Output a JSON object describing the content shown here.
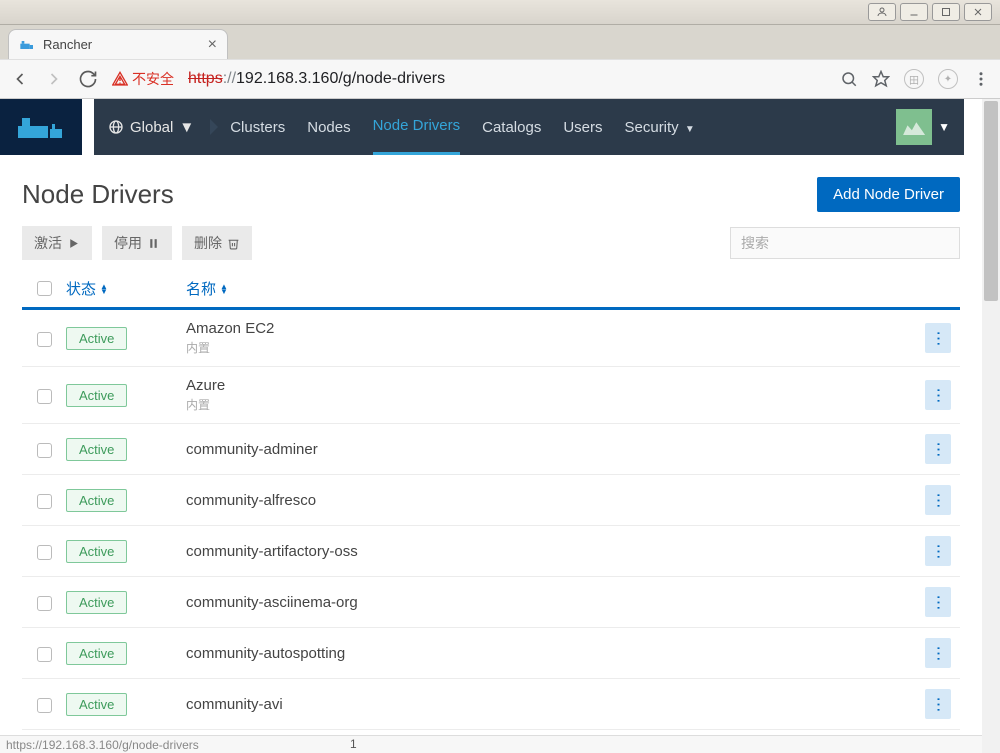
{
  "browser": {
    "tab_title": "Rancher",
    "insecure_label": "不安全",
    "url_protocol": "https",
    "url_sep": "://",
    "url_host_path": "192.168.3.160/g/node-drivers",
    "status_text": "https://192.168.3.160/g/node-drivers",
    "status_page": "1"
  },
  "header": {
    "scope_label": "Global",
    "nav": {
      "clusters": "Clusters",
      "nodes": "Nodes",
      "node_drivers": "Node Drivers",
      "catalogs": "Catalogs",
      "users": "Users",
      "security": "Security"
    }
  },
  "page": {
    "title": "Node Drivers",
    "add_button": "Add Node Driver"
  },
  "toolbar": {
    "activate": "激活",
    "deactivate": "停用",
    "delete": "删除",
    "search_placeholder": "搜索"
  },
  "table": {
    "col_status": "状态",
    "col_name": "名称",
    "builtin_label": "内置",
    "rows": [
      {
        "status": "Active",
        "name": "Amazon EC2",
        "builtin": true
      },
      {
        "status": "Active",
        "name": "Azure",
        "builtin": true
      },
      {
        "status": "Active",
        "name": "community-adminer",
        "builtin": false
      },
      {
        "status": "Active",
        "name": "community-alfresco",
        "builtin": false
      },
      {
        "status": "Active",
        "name": "community-artifactory-oss",
        "builtin": false
      },
      {
        "status": "Active",
        "name": "community-asciinema-org",
        "builtin": false
      },
      {
        "status": "Active",
        "name": "community-autospotting",
        "builtin": false
      },
      {
        "status": "Active",
        "name": "community-avi",
        "builtin": false
      }
    ]
  }
}
